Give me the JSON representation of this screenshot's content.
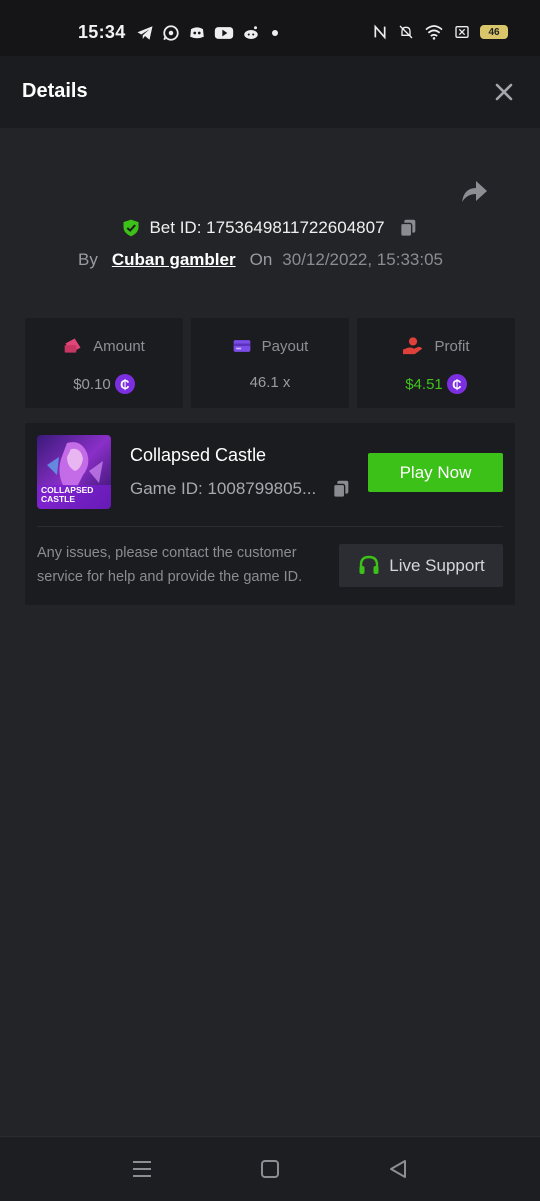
{
  "status_bar": {
    "time": "15:34",
    "battery": "46",
    "icons": [
      "telegram-icon",
      "whatsapp-icon",
      "discord-icon",
      "youtube-icon",
      "reddit-icon",
      "dot-icon",
      "nfc-icon",
      "bell-off-icon",
      "wifi-icon",
      "sim-x-icon",
      "battery-icon"
    ]
  },
  "header": {
    "title": "Details",
    "close_icon": "close-icon"
  },
  "share_icon": "share-icon",
  "bet": {
    "id_label": "Bet ID: 1753649811722604807",
    "by_label": "By",
    "username": "Cuban gambler",
    "on_label": "On",
    "date": "30/12/2022, 15:33:05"
  },
  "stats": {
    "amount": {
      "label": "Amount",
      "value": "$0.10",
      "icon": "money-icon"
    },
    "payout": {
      "label": "Payout",
      "value": "46.1 x",
      "icon": "card-icon"
    },
    "profit": {
      "label": "Profit",
      "value": "$4.51",
      "icon": "hand-coin-icon",
      "color": "#3fc21c"
    }
  },
  "coin_symbol": "₵",
  "game": {
    "name": "Collapsed Castle",
    "id_label": "Game ID: 1008799805...",
    "thumb_text_1": "COLLAPSED",
    "thumb_text_2": "CASTLE",
    "play_label": "Play Now"
  },
  "support": {
    "text": "Any issues, please contact the customer service for help and provide the game ID.",
    "button_label": "Live Support"
  },
  "colors": {
    "accent_green": "#3bc117",
    "coin_purple": "#7b2fe0",
    "pink": "#e2457a",
    "violet": "#7b4ce8",
    "red": "#e0403a"
  }
}
